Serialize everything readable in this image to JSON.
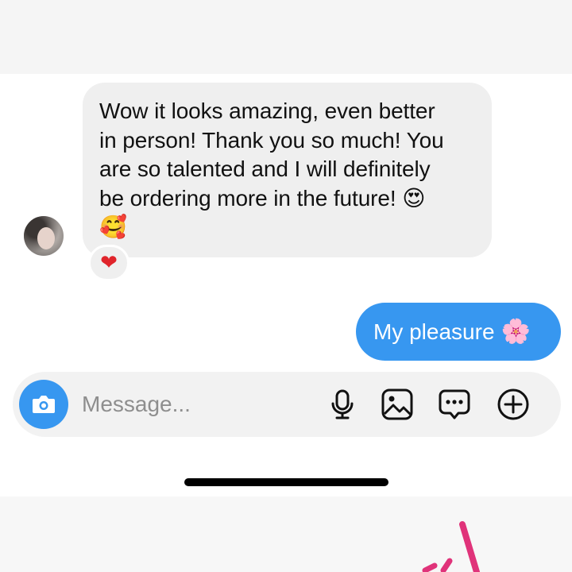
{
  "conversation": {
    "incoming_message": {
      "lines": [
        "Wow it looks amazing, even better",
        "in person! Thank you so much! You",
        "are so talented and I will definitely",
        "be ordering more in the future!"
      ],
      "emoji_inline": "😍",
      "emoji_next_line": "🥰",
      "reaction": "❤"
    },
    "outgoing_message": {
      "text": "My pleasure",
      "emoji": "🌸"
    }
  },
  "composer": {
    "placeholder": "Message..."
  },
  "colors": {
    "accent_blue": "#3797f0",
    "incoming_bubble": "#efefef",
    "reaction_heart": "#e0242b",
    "decoration_pink": "#e0337a"
  },
  "icons": [
    "camera-icon",
    "microphone-icon",
    "gallery-icon",
    "sticker-icon",
    "plus-icon"
  ]
}
